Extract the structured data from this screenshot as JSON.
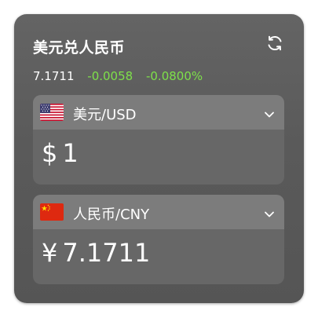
{
  "widget": {
    "title": "美元兑人民币",
    "refresh_icon": "refresh-icon"
  },
  "rate": {
    "value": "7.1711",
    "change": "-0.0058",
    "change_percent": "-0.0800%",
    "change_color": "#7ee04a"
  },
  "from_currency": {
    "flag_icon": "us-flag-icon",
    "label": "美元/USD",
    "symbol": "$",
    "amount": "1",
    "dropdown_icon": "chevron-down-icon"
  },
  "to_currency": {
    "flag_icon": "cn-flag-icon",
    "label": "人民币/CNY",
    "symbol": "¥",
    "amount": "7.1711",
    "dropdown_icon": "chevron-down-icon"
  },
  "colors": {
    "card_background": "#5c5c5c",
    "panel_header": "#7c7c7c",
    "panel_body": "#676767",
    "positive_accent": "#7ee04a"
  }
}
